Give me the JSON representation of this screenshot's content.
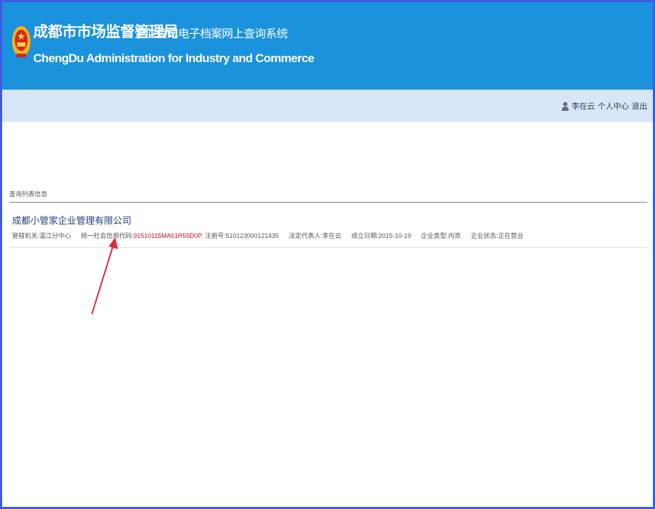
{
  "header": {
    "title_cn": "成都市市场监督管理局",
    "system_name": "企业登记电子档案网上查询系统",
    "title_en": "ChengDu Administration for Industry and Commerce"
  },
  "userbar": {
    "username": "李在云",
    "profile_link": "个人中心",
    "logout_link": "退出"
  },
  "results": {
    "section_label": "查询列表信息",
    "company": {
      "name": "成都小管家企业管理有限公司",
      "authority_label": "管辖机关:",
      "authority_value": "温江分中心",
      "credit_code_label": "统一社会信用代码:",
      "credit_code_value": "91510115MA61R55D0P",
      "reg_no_label": "注册号:",
      "reg_no_value": "510123000121435",
      "legal_rep_label": "法定代表人:",
      "legal_rep_value": "李在云",
      "established_label": "成立日期:",
      "established_value": "2015-10-19",
      "type_label": "企业类型:",
      "type_value": "内资",
      "status_label": "企业状态:",
      "status_value": "正在营业"
    }
  },
  "colors": {
    "header_bg": "#1a92dc",
    "userbar_bg": "#d9e6f9",
    "annotation_red": "#e0283a",
    "frame_border": "#3d5be0"
  },
  "icons": {
    "emblem": "national-emblem-icon",
    "user": "user-icon",
    "annotation": "red-arrow-annotation"
  }
}
